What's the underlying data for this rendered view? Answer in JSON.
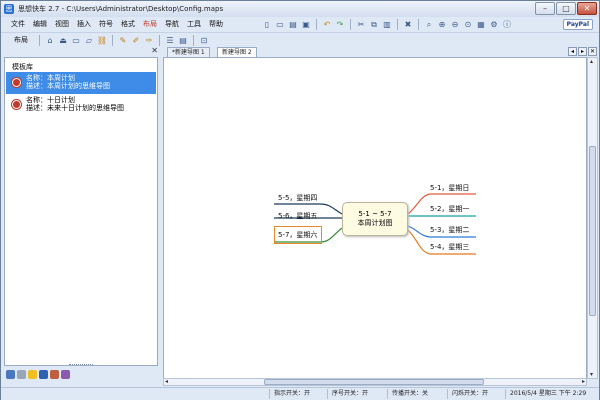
{
  "window": {
    "app_name": "思想快车 2.7",
    "path": "C:\\Users\\Administrator\\Desktop\\Config.maps"
  },
  "menu": [
    "文件",
    "编辑",
    "视图",
    "插入",
    "符号",
    "格式",
    "布局",
    "导航",
    "工具",
    "帮助"
  ],
  "active_menu": "布局",
  "toolbar": {
    "paypal_label": "PayPal",
    "layout_label": "布局"
  },
  "left_panel": {
    "title": "模板库",
    "templates": [
      {
        "name": "名称：本周计划",
        "desc": "描述：本周计划的思维导图",
        "selected": true
      },
      {
        "name": "名称：十日计划",
        "desc": "描述：未来十日计划的思维导图",
        "selected": false
      }
    ]
  },
  "tabs": [
    {
      "label": "*新建导图 1",
      "active": false
    },
    {
      "label": "新建导图 2",
      "active": true
    }
  ],
  "mindmap": {
    "center_line1": "5-1 ~ 5-7",
    "center_line2": "本周计划图",
    "left_nodes": [
      "5-5，星期四",
      "5-6，星期五",
      "5-7，星期六"
    ],
    "right_nodes": [
      "5-1，星期日",
      "5-2，星期一",
      "5-3，星期二",
      "5-4，星期三"
    ]
  },
  "status": {
    "hint": "指示开关：开",
    "order": "序号开关：开",
    "transfer": "传播开关：关",
    "flash": "闪烁开关：开",
    "datetime": "2016/5/4 星期三 下午 2:29"
  },
  "colors": {
    "accent": "#3e8be8",
    "active_menu": "#c0392b"
  }
}
